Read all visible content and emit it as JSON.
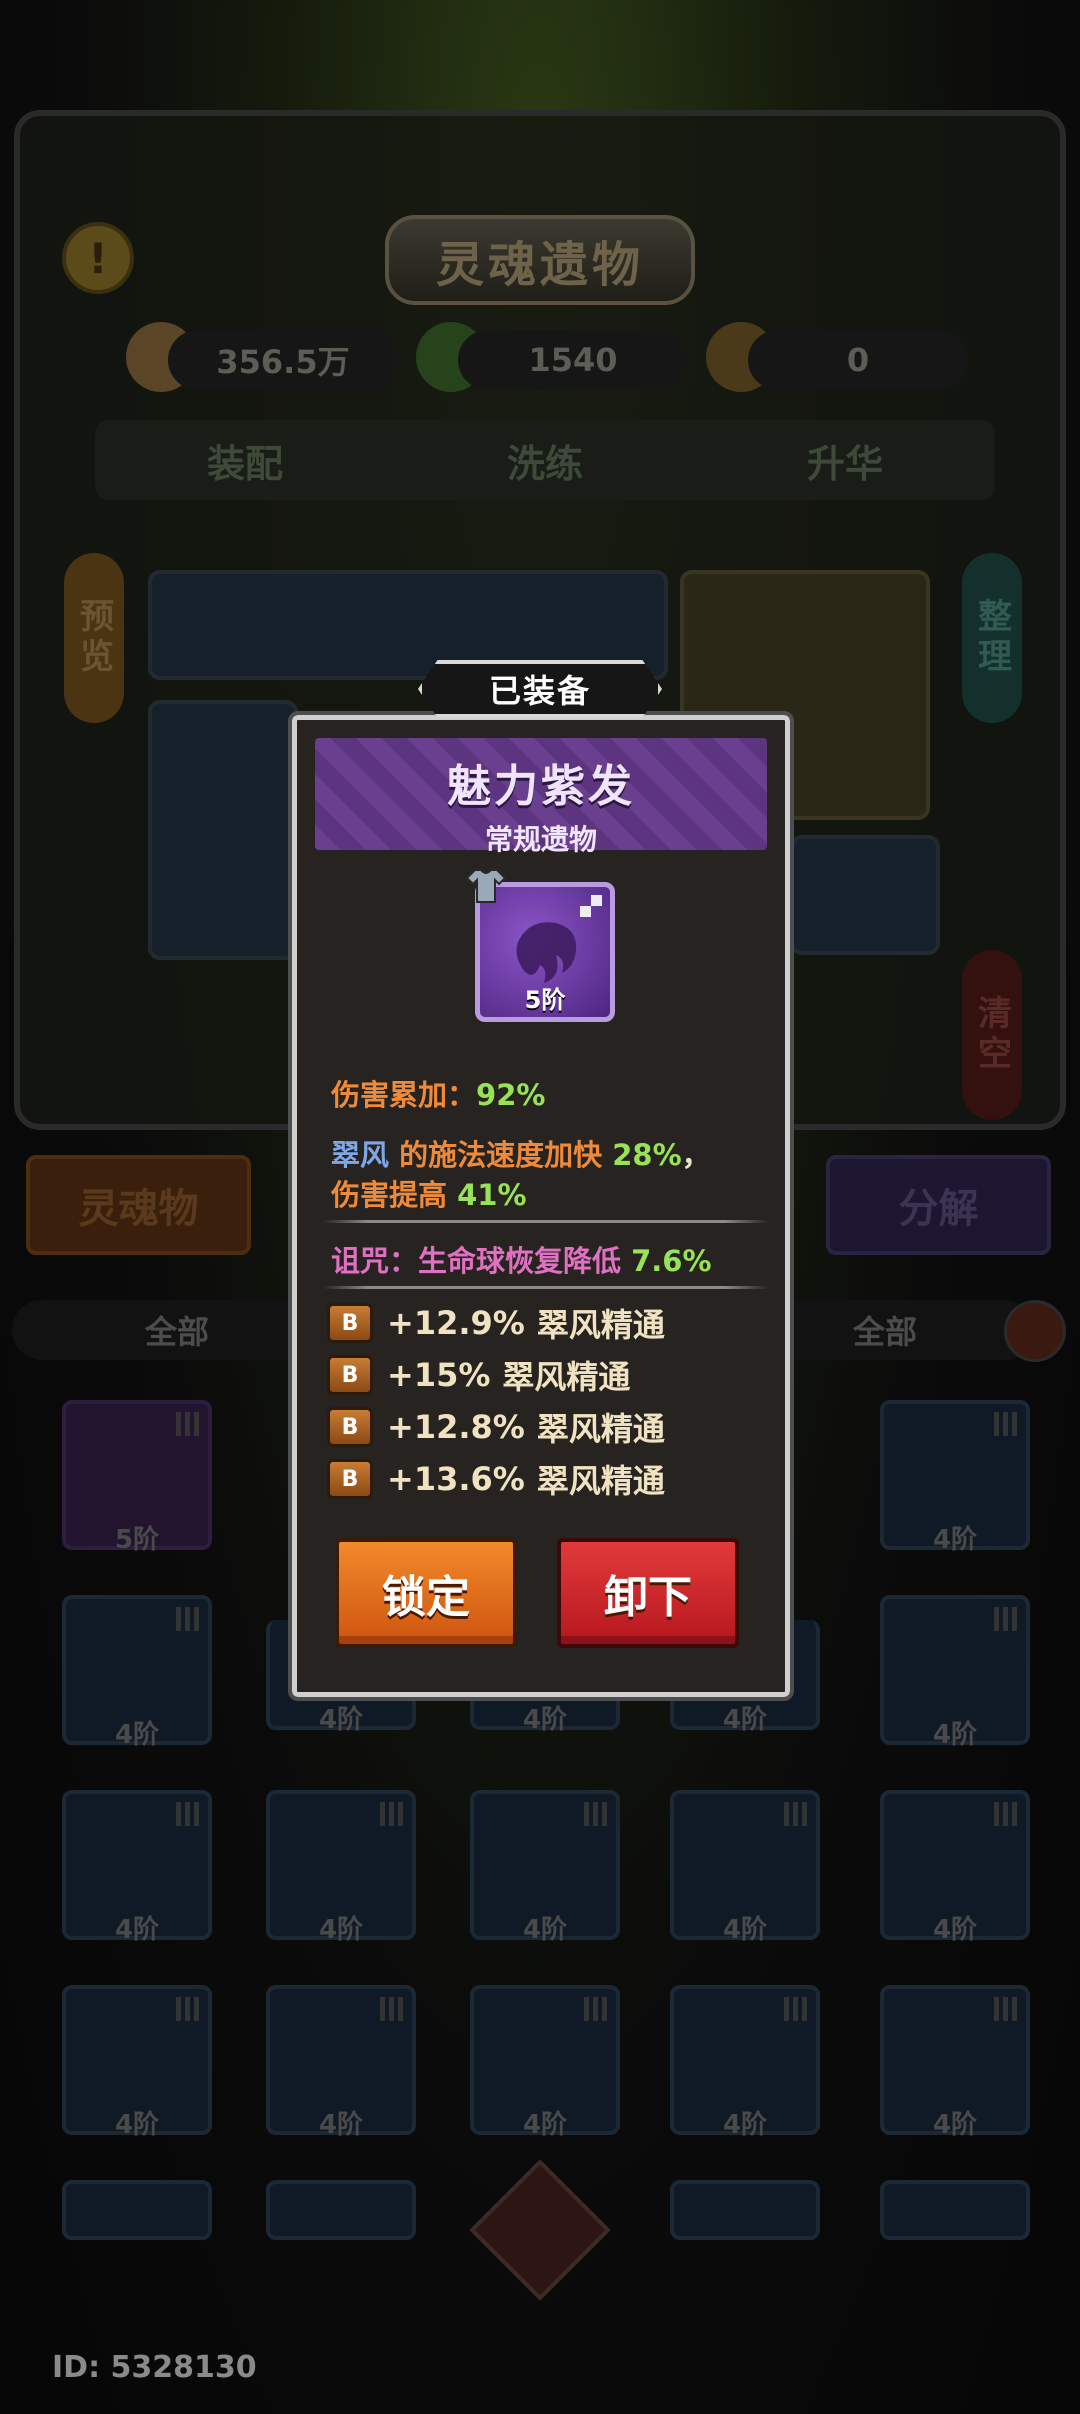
{
  "background": {
    "title": "灵魂遗物",
    "currencies": [
      {
        "icon": "coin-icon",
        "value": "356.5万"
      },
      {
        "icon": "green-soul-icon",
        "value": "1540"
      },
      {
        "icon": "tooth-icon",
        "value": "0"
      }
    ],
    "tabs": [
      "装配",
      "洗练",
      "升华"
    ],
    "side_buttons": {
      "preview": "预览",
      "sort": "整理",
      "clear": "清空"
    },
    "soul_relic_button": "灵魂物",
    "decompose_button": "分解",
    "filters": [
      "全部",
      "全部"
    ],
    "grid_levels": [
      "5阶",
      "4阶",
      "4阶",
      "4阶",
      "4阶",
      "4阶",
      "4阶",
      "4阶",
      "4阶",
      "4阶",
      "4阶",
      "4阶",
      "4阶",
      "4阶",
      "4阶",
      "4阶",
      "4阶"
    ],
    "player_id": "ID: 5328130"
  },
  "popup": {
    "equipped_label": "已装备",
    "item_name": "魅力紫发",
    "item_type": "常规遗物",
    "item_level": "5阶",
    "stats": {
      "damage_stack_label": "伤害累加：",
      "damage_stack_value": "92%",
      "skill_name": "翠风",
      "cast_speed_text": " 的施法速度加快 ",
      "cast_speed_value": "28%",
      "comma": "，",
      "damage_up_label": "伤害提高 ",
      "damage_up_value": "41%",
      "curse_label": "诅咒：生命球恢复降低 ",
      "curse_value": "7.6%"
    },
    "sub_stats": [
      {
        "badge": "B",
        "value": "+12.9%",
        "name": "翠风精通"
      },
      {
        "badge": "B",
        "value": "+15%",
        "name": "翠风精通"
      },
      {
        "badge": "B",
        "value": "+12.8%",
        "name": "翠风精通"
      },
      {
        "badge": "B",
        "value": "+13.6%",
        "name": "翠风精通"
      }
    ],
    "lock_button": "锁定",
    "unequip_button": "卸下"
  },
  "colors": {
    "popup_bg": "#262320",
    "header_purple": "#6a3f8f",
    "stat_orange": "#ef8a3a",
    "stat_green": "#98e256",
    "skill_blue": "#7fa7e6",
    "curse_pink": "#e070c2",
    "lock_orange": "#f28a2a",
    "unequip_red": "#e23a3a"
  }
}
